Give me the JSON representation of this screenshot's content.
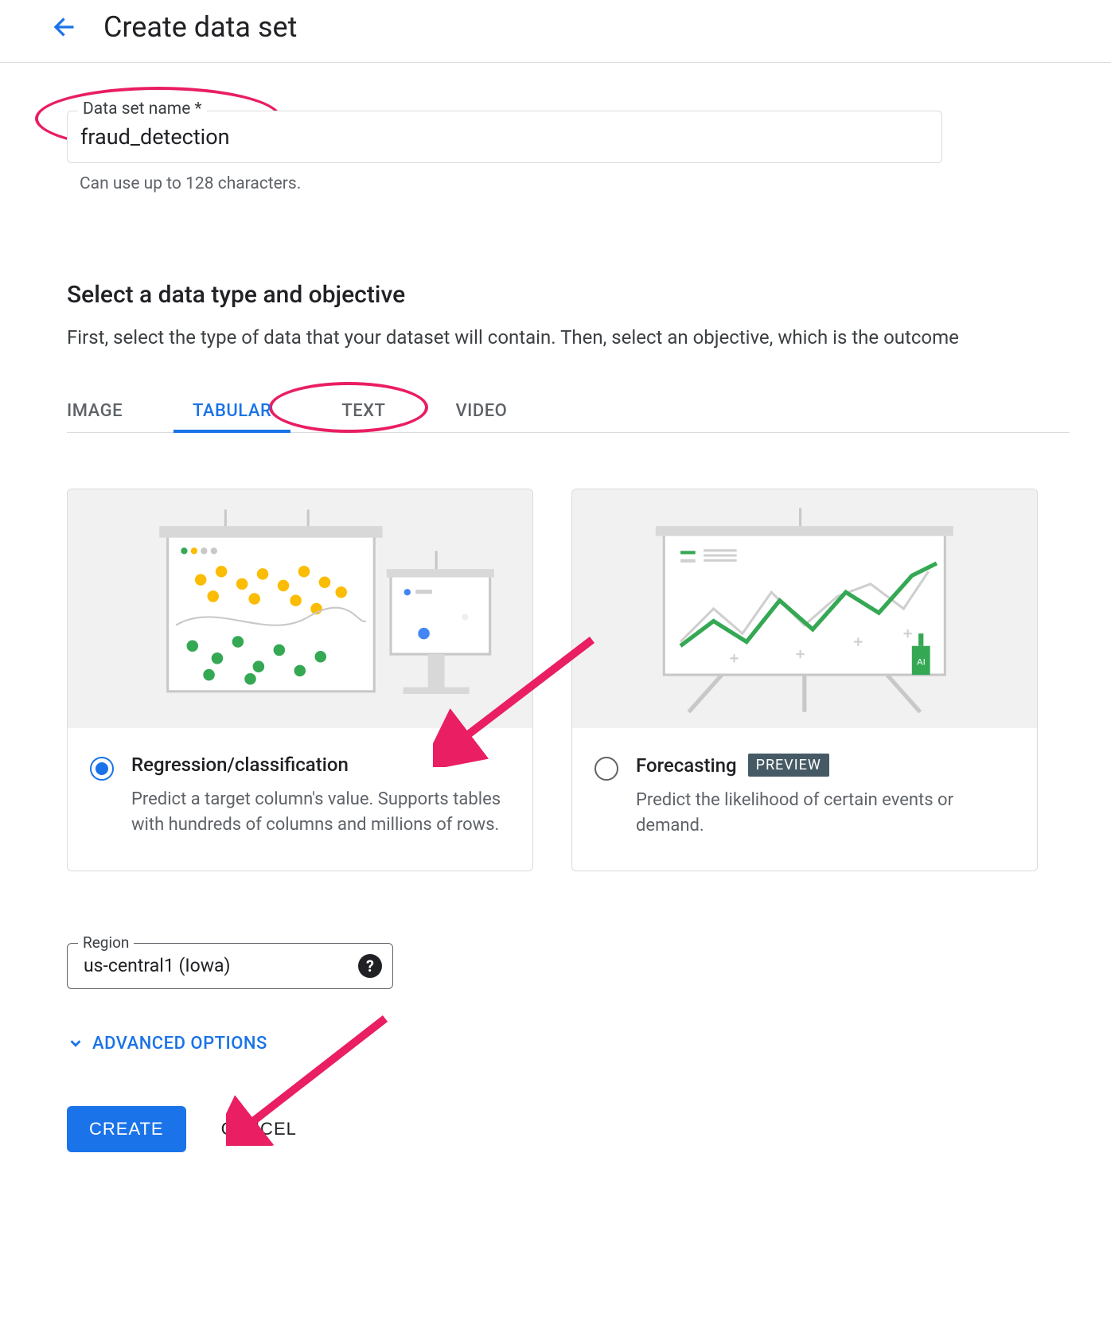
{
  "header": {
    "title": "Create data set"
  },
  "name_field": {
    "label": "Data set name *",
    "value": "fraud_detection",
    "helper": "Can use up to 128 characters."
  },
  "section": {
    "title": "Select a data type and objective",
    "description": "First, select the type of data that your dataset will contain. Then, select an objective, which is the outcome"
  },
  "tabs": {
    "items": [
      "IMAGE",
      "TABULAR",
      "TEXT",
      "VIDEO"
    ],
    "active_index": 1
  },
  "cards": [
    {
      "id": "regression",
      "title": "Regression/classification",
      "description": "Predict a target column's value. Supports tables with hundreds of columns and millions of rows.",
      "selected": true,
      "badge": null
    },
    {
      "id": "forecasting",
      "title": "Forecasting",
      "description": "Predict the likelihood of certain events or demand.",
      "selected": false,
      "badge": "PREVIEW"
    }
  ],
  "region": {
    "label": "Region",
    "value": "us-central1 (Iowa)"
  },
  "advanced": {
    "label": "ADVANCED OPTIONS"
  },
  "actions": {
    "create": "CREATE",
    "cancel": "CANCEL"
  },
  "annotations": {
    "pink": "#e91e63"
  }
}
